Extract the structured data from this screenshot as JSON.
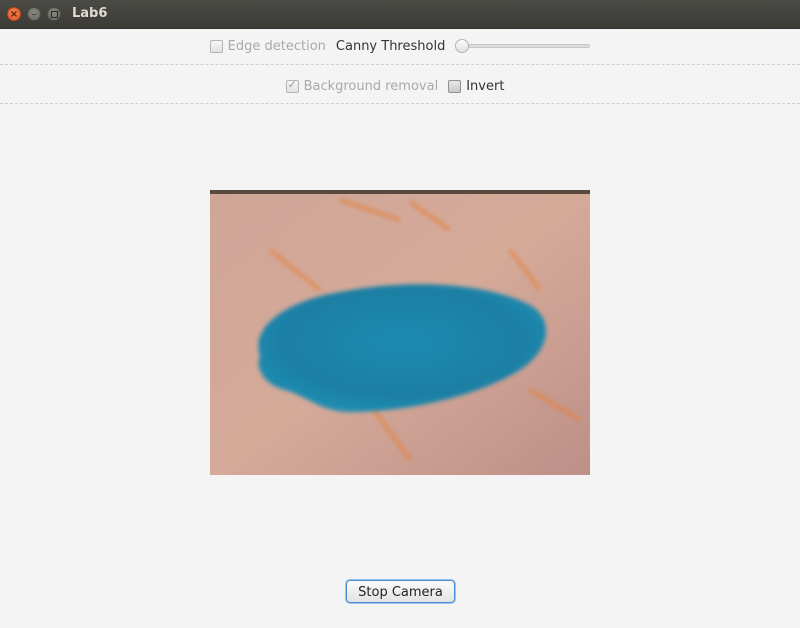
{
  "window": {
    "title": "Lab6"
  },
  "toolbar1": {
    "edge_detection_label": "Edge detection",
    "edge_detection_checked": false,
    "canny_label": "Canny Threshold",
    "canny_value": 0
  },
  "toolbar2": {
    "background_removal_label": "Background removal",
    "background_removal_checked": true,
    "invert_label": "Invert",
    "invert_checked": false
  },
  "camera": {
    "icon": "camera-frame"
  },
  "footer": {
    "stop_label": "Stop Camera"
  }
}
